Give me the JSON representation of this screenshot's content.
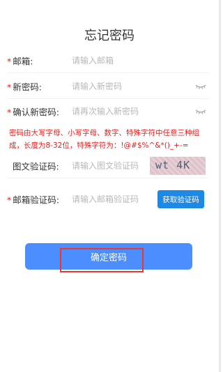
{
  "page": {
    "title": "忘记密码"
  },
  "form": {
    "email": {
      "required_mark": "*",
      "label": "邮箱:",
      "placeholder": "请输入邮箱"
    },
    "new_password": {
      "required_mark": "*",
      "label": "新密码:",
      "placeholder": "请输入新密码",
      "toggle_icon": "eye-closed-icon"
    },
    "confirm_password": {
      "required_mark": "*",
      "label": "确认新密码:",
      "placeholder": "请再次输入新密码",
      "toggle_icon": "eye-closed-icon"
    },
    "password_rule": "密码由大写字母、小写字母、数字、特殊字符中任意三种组成，长度为8-32位，特殊字符为：!@#$%^&*()_+-=",
    "captcha": {
      "label": "图文验证码:",
      "placeholder": "请输入图文验证码",
      "image_text": "wt 4K"
    },
    "email_code": {
      "required_mark": "*",
      "label": "邮箱验证码:",
      "placeholder": "请输入邮箱验证码",
      "button_label": "获取验证码"
    }
  },
  "submit": {
    "label": "确定密码"
  },
  "colors": {
    "primary": "#4d8eff",
    "button_blue": "#1e88e5",
    "required": "#e02020",
    "highlight": "#e53935"
  }
}
